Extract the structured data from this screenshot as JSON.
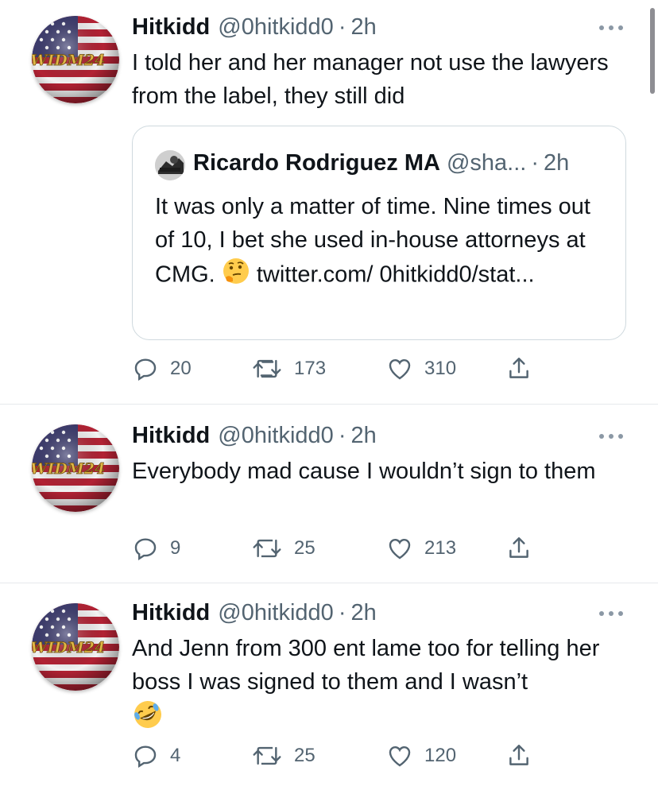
{
  "colors": {
    "text": "#0f1419",
    "muted": "#536471",
    "border": "#cfd9de",
    "icon": "#536471"
  },
  "tweets": [
    {
      "author": {
        "name": "Hitkidd",
        "handle": "@0hitkidd0",
        "avatar_text": "WIDM24"
      },
      "time": "2h",
      "text": "I told her and her manager not use the lawyers from the label, they still did",
      "quote": {
        "author": {
          "name": "Ricardo Rodriguez MA",
          "handle": "@sha..."
        },
        "time": "2h",
        "text_before_emoji": "It was only a matter of time. Nine times out of 10, I bet she used in-house attorneys at CMG.",
        "emoji": "thinking-face",
        "link": "twitter.com/ 0hitkidd0/stat..."
      },
      "actions": {
        "replies": "20",
        "retweets": "173",
        "likes": "310"
      }
    },
    {
      "author": {
        "name": "Hitkidd",
        "handle": "@0hitkidd0",
        "avatar_text": "WIDM24"
      },
      "time": "2h",
      "text": "Everybody mad cause I wouldn’t sign to them",
      "actions": {
        "replies": "9",
        "retweets": "25",
        "likes": "213"
      }
    },
    {
      "author": {
        "name": "Hitkidd",
        "handle": "@0hitkidd0",
        "avatar_text": "WIDM24"
      },
      "time": "2h",
      "text": "And Jenn from 300 ent lame too for telling her boss I was signed to them and I wasn’t",
      "emoji": "rolling-on-floor-laughing",
      "actions": {
        "replies": "4",
        "retweets": "25",
        "likes": "120"
      }
    }
  ]
}
